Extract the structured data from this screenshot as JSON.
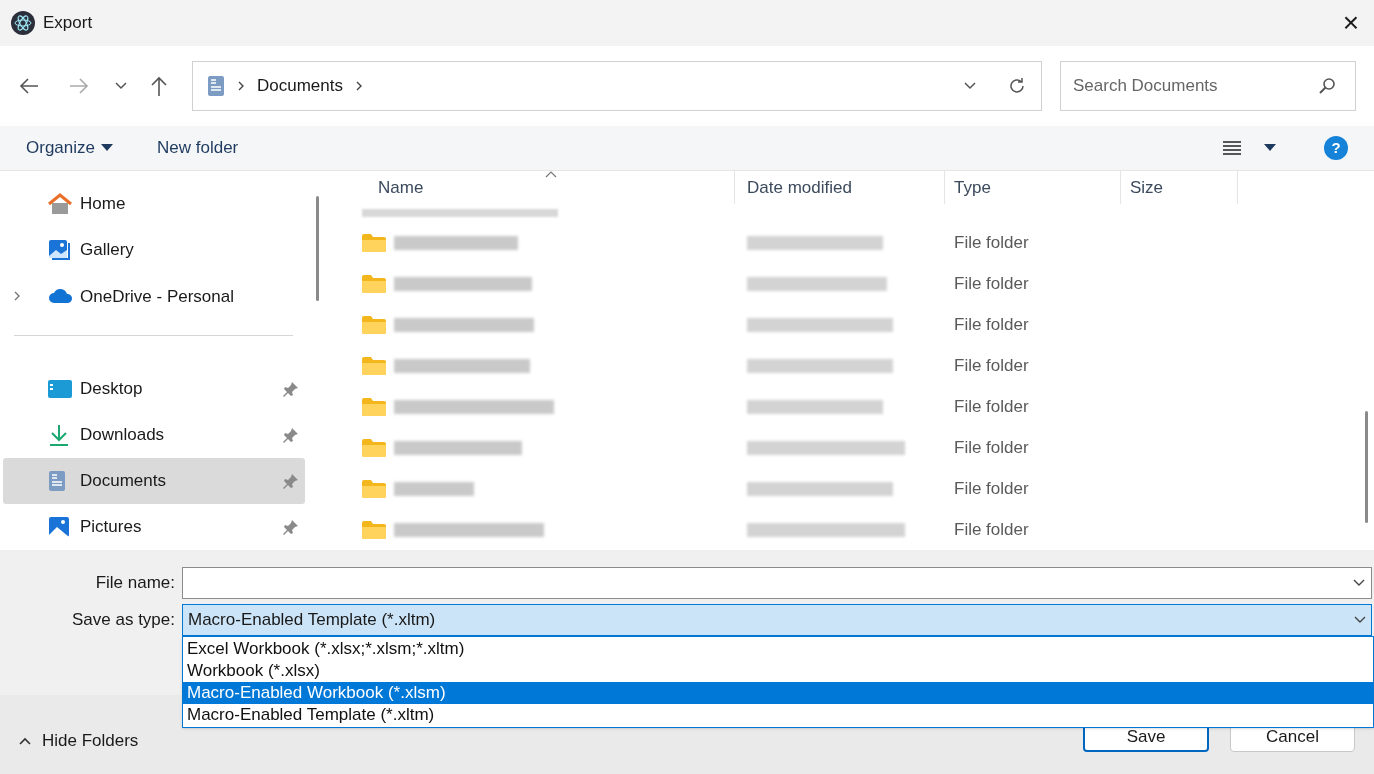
{
  "window": {
    "title": "Export",
    "close": "×"
  },
  "address": {
    "crumbs": [
      "Documents"
    ]
  },
  "search": {
    "placeholder": "Search Documents"
  },
  "command_bar": {
    "organize": "Organize",
    "new_folder": "New folder",
    "help": "?"
  },
  "sidebar": {
    "items": [
      {
        "kind": "home",
        "label": "Home",
        "selected": false,
        "pinned": false,
        "expandable": false
      },
      {
        "kind": "gallery",
        "label": "Gallery",
        "selected": false,
        "pinned": false,
        "expandable": false
      },
      {
        "kind": "onedrive",
        "label": "OneDrive - Personal",
        "selected": false,
        "pinned": false,
        "expandable": true
      },
      {
        "kind": "divider"
      },
      {
        "kind": "desktop",
        "label": "Desktop",
        "selected": false,
        "pinned": true,
        "expandable": false
      },
      {
        "kind": "downloads",
        "label": "Downloads",
        "selected": false,
        "pinned": true,
        "expandable": false
      },
      {
        "kind": "documents",
        "label": "Documents",
        "selected": true,
        "pinned": true,
        "expandable": false
      },
      {
        "kind": "pictures",
        "label": "Pictures",
        "selected": false,
        "pinned": true,
        "expandable": false
      }
    ]
  },
  "table": {
    "columns": [
      "Name",
      "Date modified",
      "Type",
      "Size"
    ],
    "rows": [
      {
        "type": "File folder"
      },
      {
        "type": "File folder"
      },
      {
        "type": "File folder"
      },
      {
        "type": "File folder"
      },
      {
        "type": "File folder"
      },
      {
        "type": "File folder"
      },
      {
        "type": "File folder"
      },
      {
        "type": "File folder"
      }
    ]
  },
  "form": {
    "file_name_label": "File name:",
    "type_label": "Save as type:",
    "type_value": "Macro-Enabled Template (*.xltm)",
    "options": [
      {
        "label": "Excel Workbook (*.xlsx;*.xlsm;*.xltm)",
        "selected": false
      },
      {
        "label": "Workbook (*.xlsx)",
        "selected": false
      },
      {
        "label": "Macro-Enabled Workbook (*.xlsm)",
        "selected": true
      },
      {
        "label": "Macro-Enabled Template (*.xltm)",
        "selected": false
      }
    ]
  },
  "footer": {
    "hide_folders": "Hide Folders",
    "save": "Save",
    "cancel": "Cancel"
  }
}
